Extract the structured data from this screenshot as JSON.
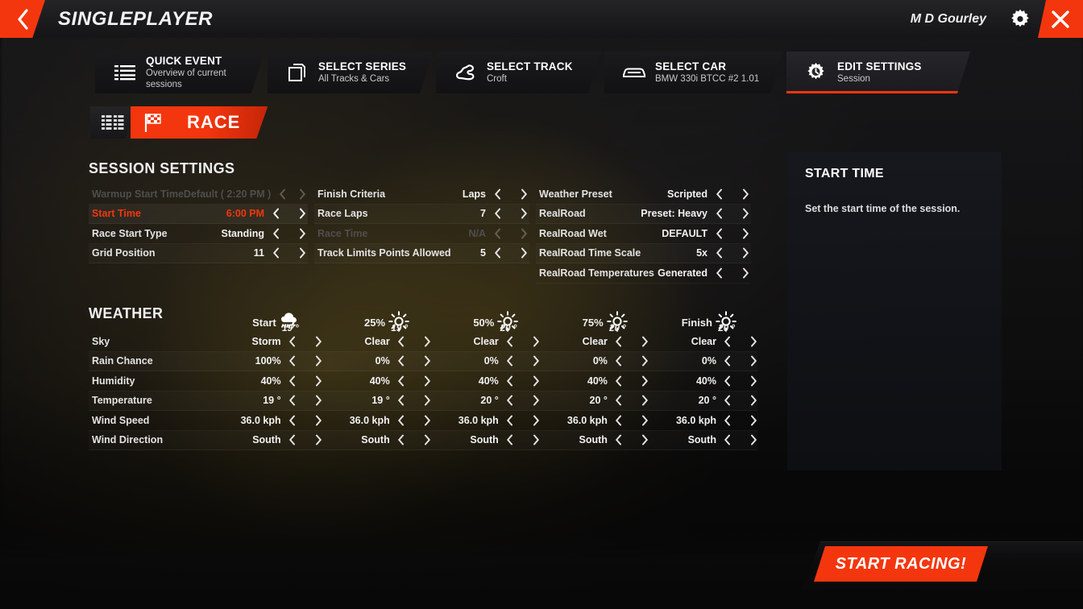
{
  "topbar": {
    "back_icon": "chevron-left-icon",
    "title": "SINGLEPLAYER",
    "username": "M D Gourley",
    "gear_icon": "gear-icon",
    "close_icon": "close-icon",
    "accent_color": "#f4360e"
  },
  "nav_tabs": [
    {
      "icon": "list-icon",
      "title": "QUICK EVENT",
      "subtitle": "Overview of current sessions",
      "active": false
    },
    {
      "icon": "cards-icon",
      "title": "SELECT SERIES",
      "subtitle": "All Tracks & Cars",
      "active": false
    },
    {
      "icon": "track-icon",
      "title": "SELECT TRACK",
      "subtitle": "Croft",
      "active": false
    },
    {
      "icon": "car-icon",
      "title": "SELECT CAR",
      "subtitle": "BMW 330i BTCC #2 1.01",
      "active": false
    },
    {
      "icon": "cog-clock-icon",
      "title": "EDIT SETTINGS",
      "subtitle": "Session",
      "active": true
    }
  ],
  "race_bar": {
    "list_icon": "grid-list-icon",
    "flag_icon": "checkered-flag-icon",
    "label": "RACE"
  },
  "session": {
    "title": "SESSION SETTINGS",
    "columns": [
      {
        "rows": [
          {
            "label": "Warmup Start Time",
            "value": "Default ( 2:20 PM )",
            "state": "disabled"
          },
          {
            "label": "Start Time",
            "value": "6:00 PM",
            "state": "selected"
          },
          {
            "label": "Race Start Type",
            "value": "Standing",
            "state": "normal"
          },
          {
            "label": "Grid Position",
            "value": "11",
            "state": "normal"
          }
        ]
      },
      {
        "rows": [
          {
            "label": "Finish Criteria",
            "value": "Laps",
            "state": "normal"
          },
          {
            "label": "Race Laps",
            "value": "7",
            "state": "normal"
          },
          {
            "label": "Race Time",
            "value": "N/A",
            "state": "disabled"
          },
          {
            "label": "Track Limits Points Allowed",
            "value": "5",
            "state": "normal"
          }
        ]
      },
      {
        "rows": [
          {
            "label": "Weather Preset",
            "value": "Scripted",
            "state": "normal"
          },
          {
            "label": "RealRoad",
            "value": "Preset: Heavy",
            "state": "normal"
          },
          {
            "label": "RealRoad Wet",
            "value": "DEFAULT",
            "state": "normal"
          },
          {
            "label": "RealRoad Time Scale",
            "value": "5x",
            "state": "normal"
          },
          {
            "label": "RealRoad Temperatures",
            "value": "Generated",
            "state": "normal"
          }
        ]
      }
    ]
  },
  "weather": {
    "title": "WEATHER",
    "columns": [
      {
        "stage": "Start",
        "icon": "storm-icon",
        "temp": "19 °"
      },
      {
        "stage": "25%",
        "icon": "sun-icon",
        "temp": "19 °"
      },
      {
        "stage": "50%",
        "icon": "sun-icon",
        "temp": "20 °"
      },
      {
        "stage": "75%",
        "icon": "sun-icon",
        "temp": "20 °"
      },
      {
        "stage": "Finish",
        "icon": "sun-icon",
        "temp": "20 °"
      }
    ],
    "rows": [
      {
        "label": "Sky",
        "values": [
          "Storm",
          "Clear",
          "Clear",
          "Clear",
          "Clear"
        ]
      },
      {
        "label": "Rain Chance",
        "values": [
          "100%",
          "0%",
          "0%",
          "0%",
          "0%"
        ]
      },
      {
        "label": "Humidity",
        "values": [
          "40%",
          "40%",
          "40%",
          "40%",
          "40%"
        ]
      },
      {
        "label": "Temperature",
        "values": [
          "19 °",
          "19 °",
          "20 °",
          "20 °",
          "20 °"
        ]
      },
      {
        "label": "Wind Speed",
        "values": [
          "36.0 kph",
          "36.0 kph",
          "36.0 kph",
          "36.0 kph",
          "36.0 kph"
        ]
      },
      {
        "label": "Wind Direction",
        "values": [
          "South",
          "South",
          "South",
          "South",
          "South"
        ]
      }
    ]
  },
  "info_panel": {
    "title": "START TIME",
    "description": "Set the start time of the session."
  },
  "start_button": {
    "label": "START RACING!"
  }
}
